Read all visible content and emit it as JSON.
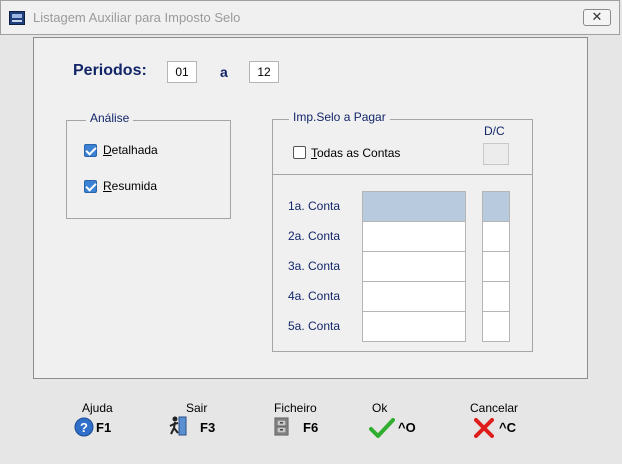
{
  "window": {
    "title": "Listagem Auxiliar para Imposto Selo",
    "close_label": "✕"
  },
  "periodos": {
    "label": "Periodos:",
    "from": "01",
    "sep": "a",
    "to": "12"
  },
  "analise": {
    "legend": "Análise",
    "detalhada": {
      "label": "Detalhada",
      "checked": true
    },
    "resumida": {
      "label": "Resumida",
      "checked": true
    }
  },
  "impselo": {
    "legend": "Imp.Selo a Pagar",
    "dc_header": "D/C",
    "todas": {
      "label": "Todas as Contas",
      "checked": false
    },
    "rows": [
      {
        "label": "1a. Conta",
        "value": "",
        "dc": ""
      },
      {
        "label": "2a. Conta",
        "value": "",
        "dc": ""
      },
      {
        "label": "3a. Conta",
        "value": "",
        "dc": ""
      },
      {
        "label": "4a. Conta",
        "value": "",
        "dc": ""
      },
      {
        "label": "5a. Conta",
        "value": "",
        "dc": ""
      }
    ]
  },
  "fkeys": [
    {
      "caption": "Ajuda",
      "key": "F1",
      "icon": "help-icon"
    },
    {
      "caption": "Sair",
      "key": "F3",
      "icon": "exit-icon"
    },
    {
      "caption": "Ficheiro",
      "key": "F6",
      "icon": "file-cabinet-icon"
    },
    {
      "caption": "Ok",
      "key": "^O",
      "icon": "checkmark-icon"
    },
    {
      "caption": "Cancelar",
      "key": "^C",
      "icon": "cross-icon"
    }
  ],
  "colors": {
    "label_blue": "#13266a",
    "selected_cell": "#b7cade",
    "check_blue": "#3b82d4"
  }
}
